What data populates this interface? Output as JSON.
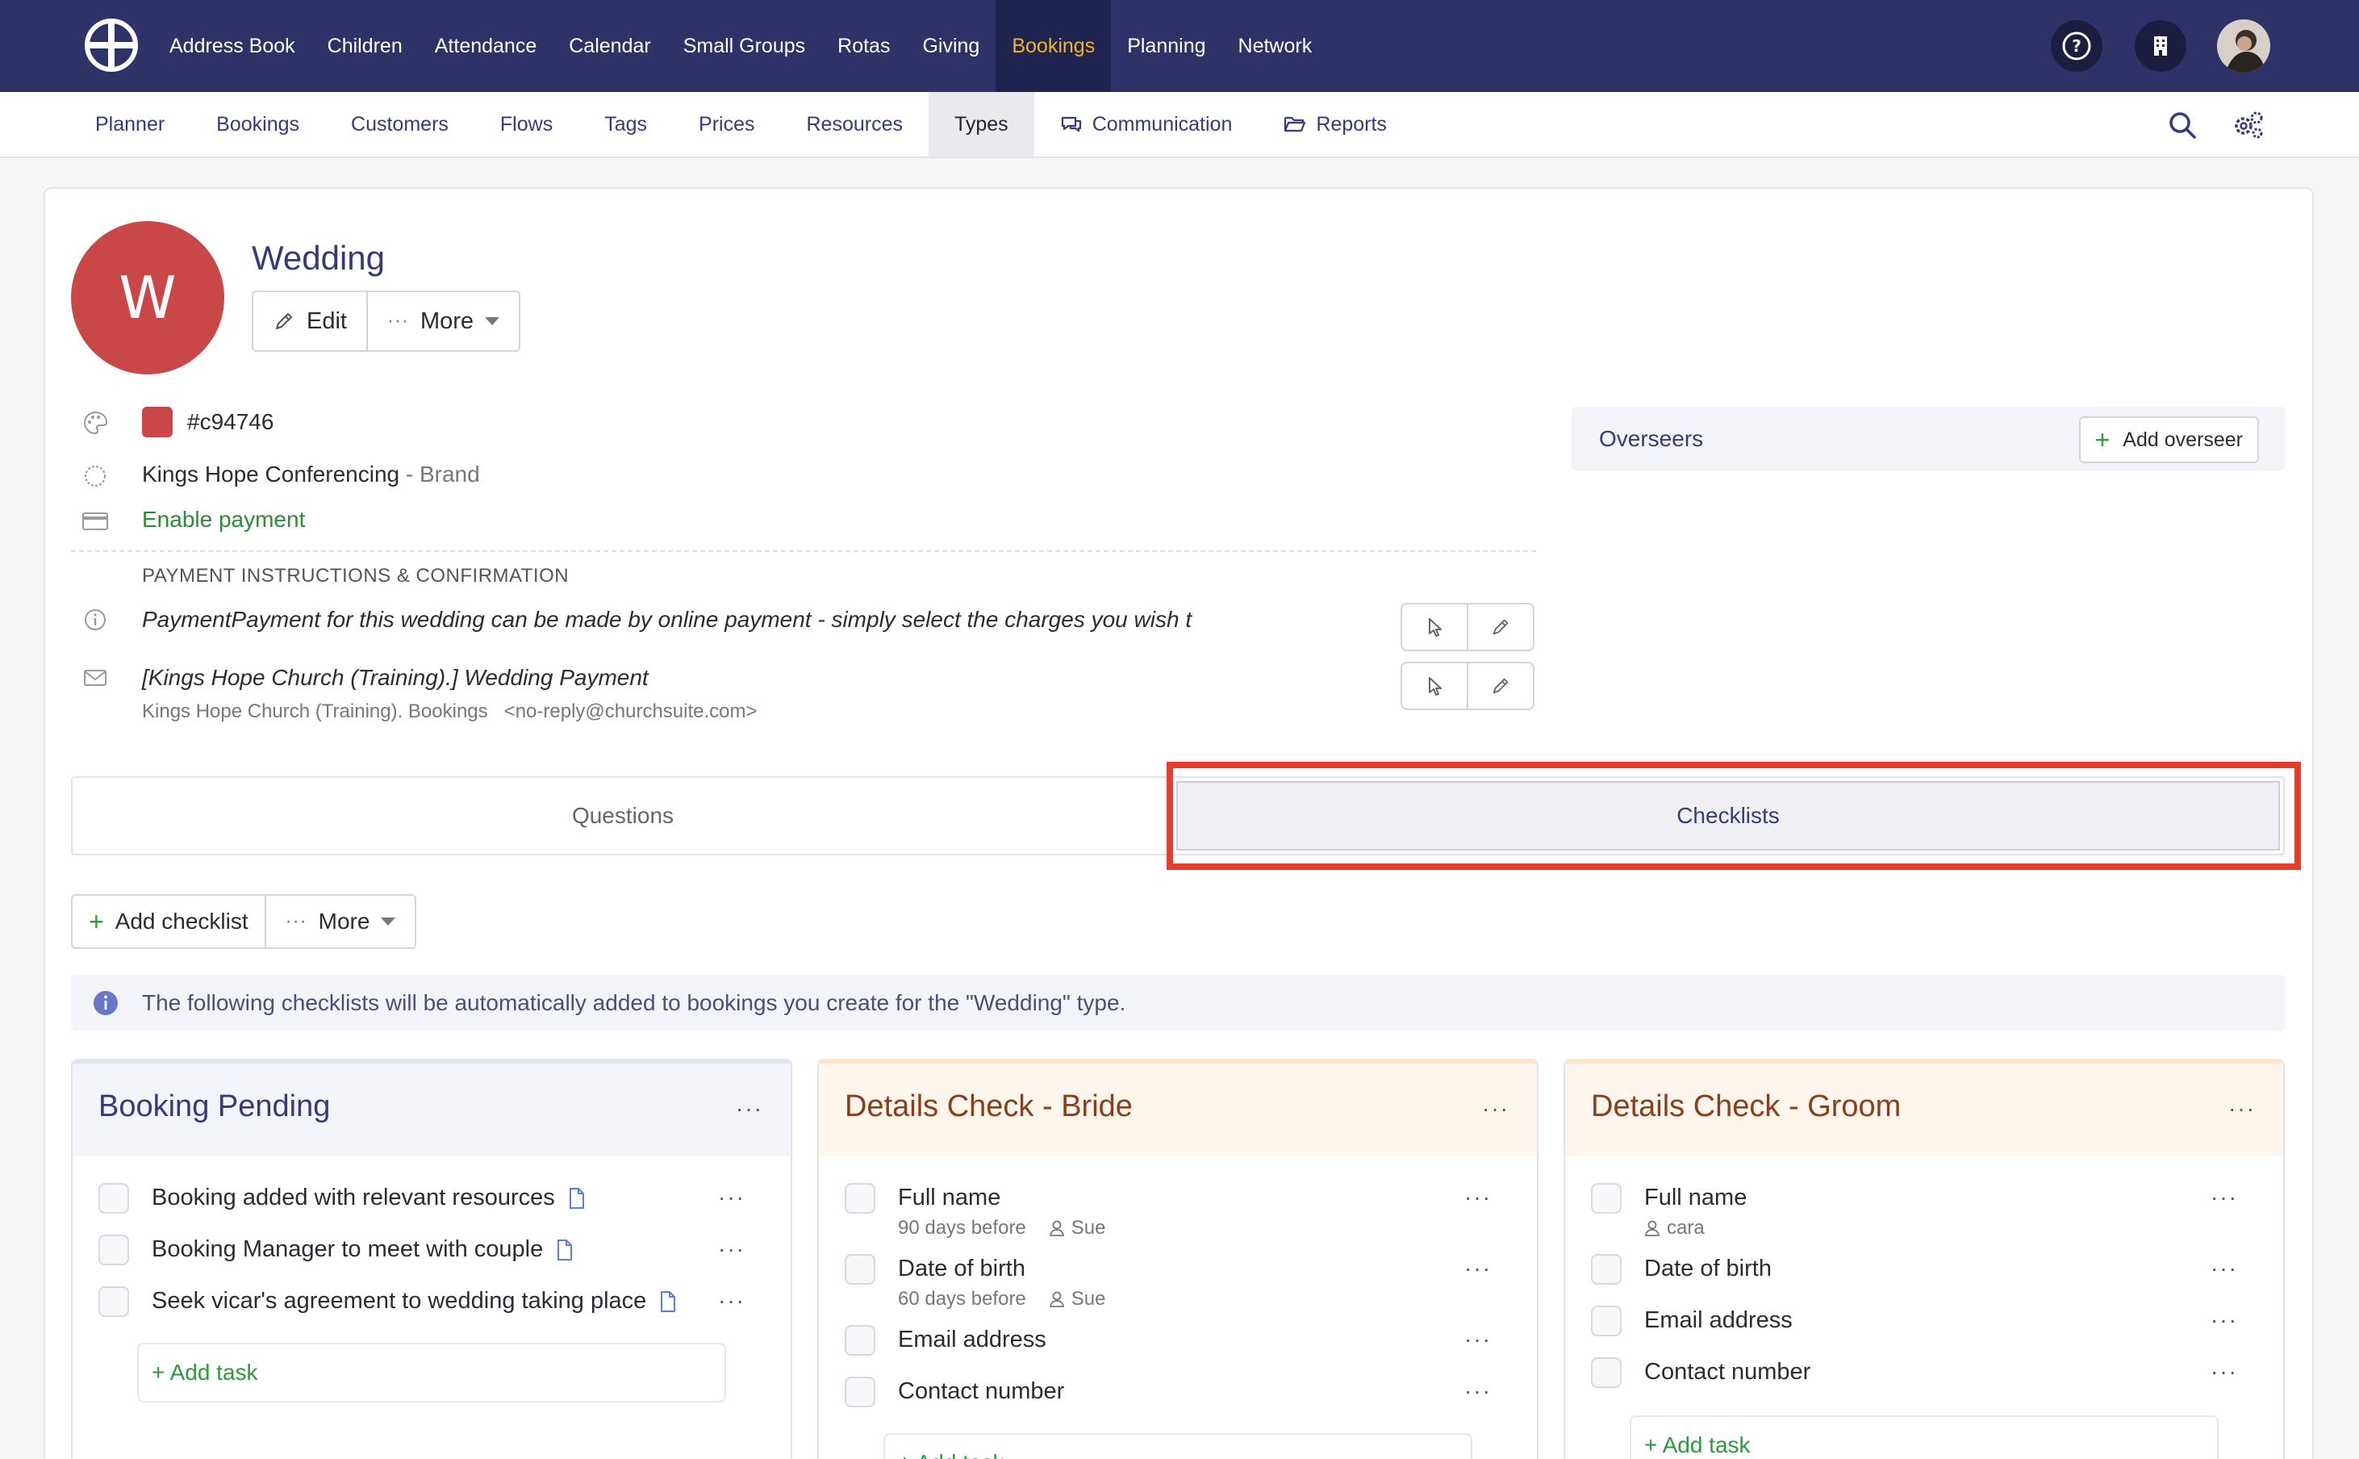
{
  "topnav": {
    "items": [
      "Address Book",
      "Children",
      "Attendance",
      "Calendar",
      "Small Groups",
      "Rotas",
      "Giving",
      "Bookings",
      "Planning",
      "Network"
    ],
    "active": "Bookings"
  },
  "subnav": {
    "items": [
      "Planner",
      "Bookings",
      "Customers",
      "Flows",
      "Tags",
      "Prices",
      "Resources",
      "Types",
      "Communication",
      "Reports"
    ],
    "active": "Types"
  },
  "type": {
    "initial": "W",
    "name": "Wedding",
    "color_hex": "#c94746",
    "edit_label": "Edit",
    "more_label": "More",
    "brand_name": "Kings Hope Conferencing",
    "brand_suffix": "- Brand",
    "payment_link": "Enable payment",
    "payment_section_label": "PAYMENT INSTRUCTIONS & CONFIRMATION",
    "payment_text": "PaymentPayment for this wedding can be made by online payment - simply select the charges you wish t",
    "email_subject": "[Kings Hope Church (Training).] Wedding Payment",
    "email_sender": "Kings Hope Church (Training). Bookings",
    "email_address": "<no-reply@churchsuite.com>"
  },
  "overseers": {
    "label": "Overseers",
    "add_label": "Add overseer"
  },
  "tabs": {
    "questions": "Questions",
    "checklists": "Checklists"
  },
  "toolbar": {
    "add_checklist": "Add checklist",
    "more": "More"
  },
  "info_message": "The following checklists will be automatically added to bookings you create for the \"Wedding\" type.",
  "checklists": [
    {
      "title": "Booking Pending",
      "tasks": [
        {
          "label": "Booking added with relevant resources",
          "doc": true
        },
        {
          "label": "Booking Manager to meet with couple",
          "doc": true
        },
        {
          "label": "Seek vicar's agreement to wedding taking place",
          "doc": true
        }
      ],
      "add_task": "+ Add task"
    },
    {
      "title": "Details Check - Bride",
      "tasks": [
        {
          "label": "Full name",
          "due": "90 days before",
          "assignee": "Sue"
        },
        {
          "label": "Date of birth",
          "due": "60 days before",
          "assignee": "Sue"
        },
        {
          "label": "Email address"
        },
        {
          "label": "Contact number"
        }
      ],
      "add_task": "+ Add task"
    },
    {
      "title": "Details Check - Groom",
      "tasks": [
        {
          "label": "Full name",
          "assignee": "cara"
        },
        {
          "label": "Date of birth"
        },
        {
          "label": "Email address"
        },
        {
          "label": "Contact number"
        }
      ],
      "add_task": "+ Add task"
    }
  ],
  "colors": {
    "nav_bg": "#2e3266",
    "nav_active_text": "#f0b429",
    "accent": "#353b7a",
    "highlight": "#e43d2b",
    "success": "#2d9a3f"
  }
}
